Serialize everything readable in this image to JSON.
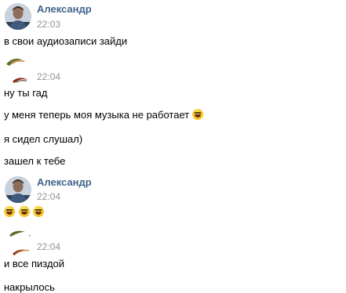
{
  "messages": [
    {
      "sender": "Александр",
      "time": "22:03",
      "lines": [
        "в свои аудиозаписи зайди"
      ]
    },
    {
      "sender": "",
      "time": "22:04",
      "lines": [
        "ну ты гад",
        "у меня теперь моя музыка не работает",
        "я сидел слушал)",
        "зашел к тебе"
      ]
    },
    {
      "sender": "Александр",
      "time": "22:04",
      "lines": []
    },
    {
      "sender": "",
      "time": "22:04",
      "lines": [
        "и все пиздой",
        "накрылось"
      ]
    }
  ],
  "emoji": {
    "laughing": "laughing-face-icon"
  },
  "colors": {
    "sender_name": "#42648b",
    "timestamp": "#939393",
    "text": "#000000",
    "background": "#ffffff"
  }
}
